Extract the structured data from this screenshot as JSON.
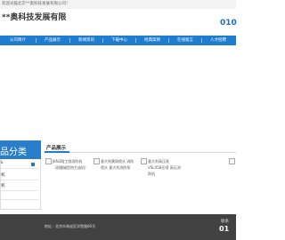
{
  "topbar": {
    "text": "欢迎光临北京**奥科技发展有限公司！"
  },
  "header": {
    "company": "**奥科技发展有限",
    "phone": "010"
  },
  "nav": {
    "items": [
      {
        "label": "公司简介"
      },
      {
        "label": "产品展示"
      },
      {
        "label": "新闻资讯"
      },
      {
        "label": "下载中心"
      },
      {
        "label": "经典案例"
      },
      {
        "label": "在线留言"
      },
      {
        "label": "人才招聘"
      }
    ]
  },
  "sidebar": {
    "title": "品分类",
    "items": [
      {
        "label": "k"
      },
      {
        "label": "机"
      },
      {
        "label": "机"
      }
    ]
  },
  "products": {
    "title": "产品展示",
    "items": [
      {
        "caption": "JKN3BJ工频消防机（耐酸碱型热力油机）"
      },
      {
        "caption": "意大利黄铜喷头 消防喷头 意大利消防泵"
      },
      {
        "caption": "意大利高压泵 VSLX5B压喷 高压消防机"
      }
    ]
  },
  "footer": {
    "address": "地址：北京市海淀区学院路66号",
    "tel_label": "联系",
    "tel": "01"
  }
}
